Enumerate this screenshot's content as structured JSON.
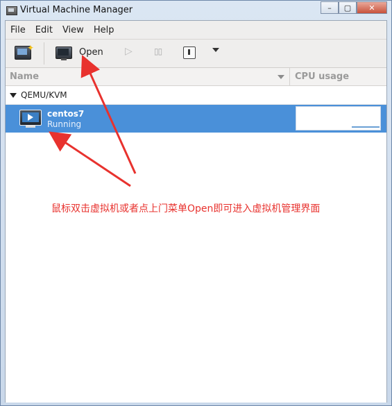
{
  "window": {
    "title": "Virtual Machine Manager",
    "controls": {
      "minimize": "–",
      "maximize": "▢",
      "close": "✕"
    }
  },
  "menubar": {
    "items": [
      {
        "label": "File"
      },
      {
        "label": "Edit"
      },
      {
        "label": "View"
      },
      {
        "label": "Help"
      }
    ]
  },
  "toolbar": {
    "new_icon": "new-vm-icon",
    "open_label": "Open",
    "play_glyph": "▷",
    "pause_glyph": "▯▯",
    "shutdown_icon": "power-icon",
    "more_icon": "chevron-down-icon"
  },
  "list": {
    "columns": {
      "name": "Name",
      "cpu": "CPU usage"
    },
    "group": "QEMU/KVM",
    "vm": {
      "name": "centos7",
      "status": "Running"
    }
  },
  "annotation": {
    "text": "鼠标双击虚拟机或者点上门菜单Open即可进入虚拟机管理界面",
    "color": "#e8322e"
  },
  "colors": {
    "selection": "#4a90d9",
    "annotation_arrow": "#e8322e"
  }
}
